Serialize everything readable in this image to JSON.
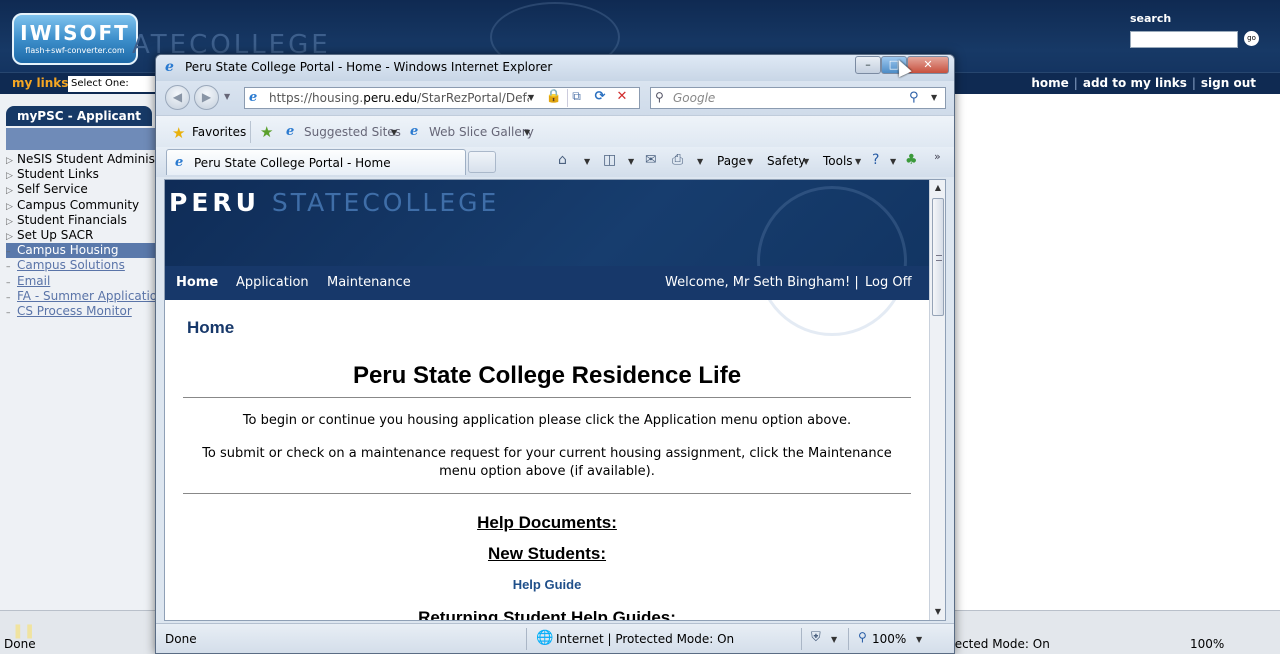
{
  "portal": {
    "logo_main": "IWISOFT",
    "logo_sub": "flash+swf-converter.com",
    "brand_partial": "ATECOLLEGE",
    "search_label": "search",
    "go_label": "go",
    "mylinks_label": "my links:",
    "mylinks_select": "Select One:",
    "top_links": [
      "home",
      "add to my links",
      "sign out"
    ],
    "tab_label": "myPSC - Applicant",
    "nav_items": [
      {
        "label": "NeSIS Student Administra",
        "type": "folder"
      },
      {
        "label": "Student Links",
        "type": "folder"
      },
      {
        "label": "Self Service",
        "type": "folder"
      },
      {
        "label": "Campus Community",
        "type": "folder"
      },
      {
        "label": "Student Financials",
        "type": "folder"
      },
      {
        "label": "Set Up SACR",
        "type": "folder"
      },
      {
        "label": "Campus Housing",
        "type": "active"
      },
      {
        "label": "Campus Solutions",
        "type": "link"
      },
      {
        "label": "Email",
        "type": "link"
      },
      {
        "label": "FA - Summer Application",
        "type": "link"
      },
      {
        "label": "CS Process Monitor",
        "type": "link"
      }
    ],
    "status_done": "Done",
    "status_mode": "tected Mode: On",
    "status_zoom": "100%"
  },
  "ie": {
    "title": "Peru State College Portal - Home - Windows Internet Explorer",
    "address_prefix": "https://housing.",
    "address_domain": "peru.edu",
    "address_suffix": "/StarRezPortal/Default",
    "search_placeholder": "Google",
    "favorites_label": "Favorites",
    "suggested_sites_label": "Suggested Sites",
    "web_slice_label": "Web Slice Gallery",
    "tab_title": "Peru State College Portal - Home",
    "cmd_page": "Page",
    "cmd_safety": "Safety",
    "cmd_tools": "Tools",
    "status_done": "Done",
    "status_zone": "Internet | Protected Mode: On",
    "status_zoom": "100%"
  },
  "page": {
    "brand_peru": "PERU",
    "brand_sc": "STATECOLLEGE",
    "menu": {
      "home": "Home",
      "application": "Application",
      "maintenance": "Maintenance",
      "welcome": "Welcome, Mr Seth Bingham!  |",
      "logoff": "Log Off"
    },
    "heading_home": "Home",
    "title": "Peru State College Residence Life",
    "para1": "To begin or continue you housing application please click the Application menu option above.",
    "para2": "To submit or check on a maintenance request for your current housing assignment, click the Maintenance menu option above (if available).",
    "help_docs": "Help Documents:",
    "new_students": "New Students:",
    "help_guide": "Help Guide",
    "returning": "Returning Student Help Guides:"
  }
}
